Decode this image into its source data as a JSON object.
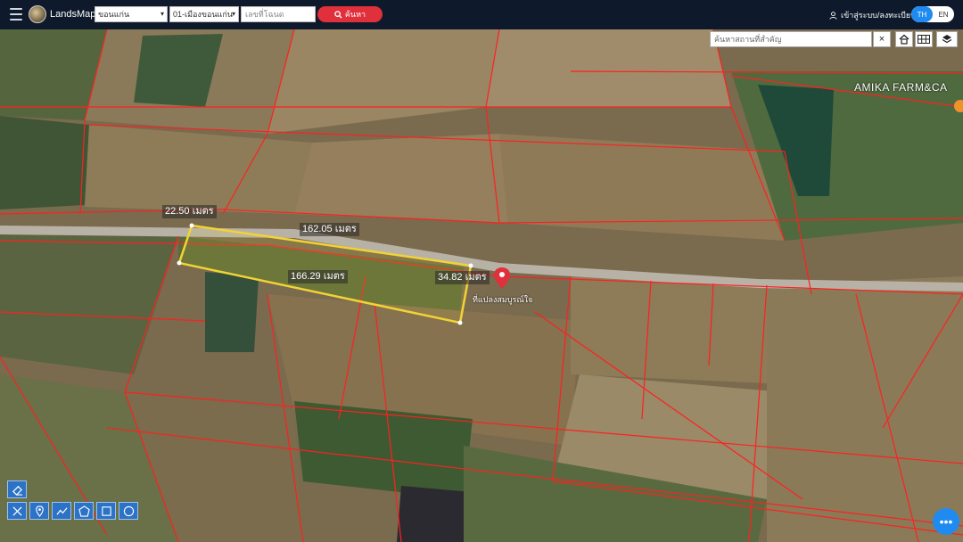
{
  "header": {
    "brand": "LandsMaps",
    "province_select": "ขอนแก่น",
    "district_select": "01-เมืองขอนแก่น",
    "deed_placeholder": "เลขที่โฉนด",
    "search_label": "ค้นหา",
    "login_label": "เข้าสู่ระบบ/ลงทะเบียน",
    "lang_th": "TH",
    "lang_en": "EN"
  },
  "map": {
    "place_search_placeholder": "ค้นหาสถานที่สำคัญ",
    "close_symbol": "×",
    "farm_label": "AMIKA FARM&CA",
    "place_name": "ที่แปลงสมบูรณ์ใจ",
    "measurements": {
      "top_short": "22.50 เมตร",
      "top_long": "162.05 เมตร",
      "bottom_long": "166.29 เมตร",
      "right_short": "34.82 เมตร"
    },
    "fab_label": "•••"
  },
  "colors": {
    "header_bg": "#0e1a2b",
    "accent_red": "#e0303b",
    "accent_blue": "#1f8bf0",
    "parcel_line": "#ff2020",
    "selection": "#f2d335"
  }
}
